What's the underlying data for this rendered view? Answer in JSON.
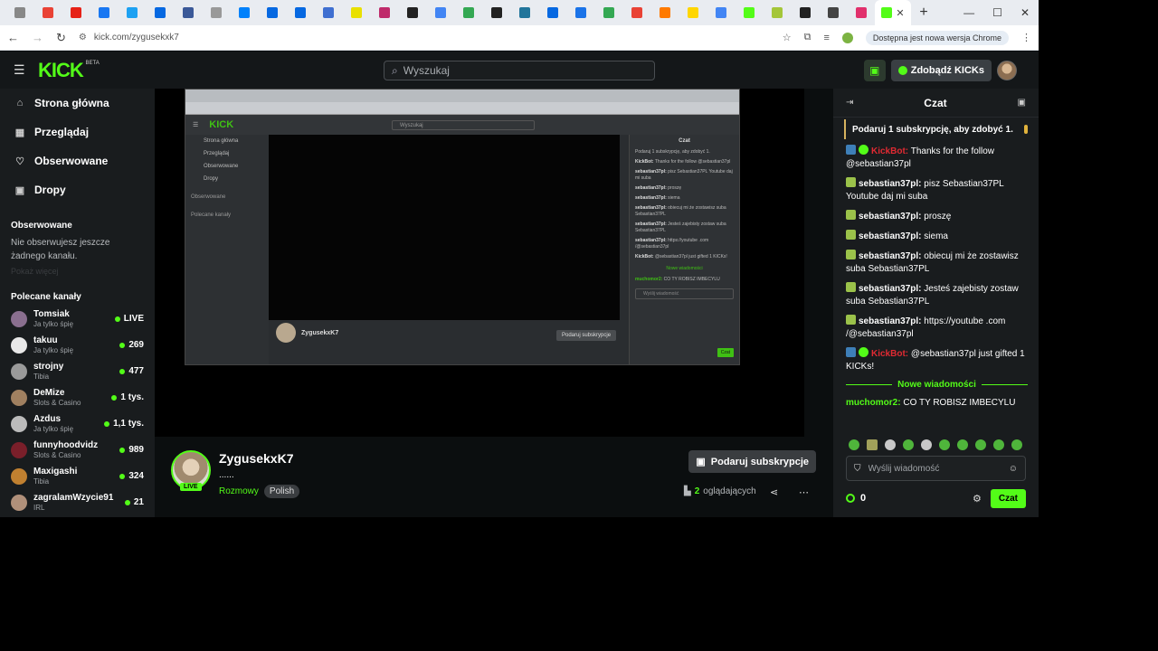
{
  "browser": {
    "tab_favicons": [
      "#888",
      "#e94235",
      "#e62117",
      "#1877f2",
      "#1da1f2",
      "#0668e1",
      "#3b5998",
      "#999",
      "#0081fb",
      "#0668e1",
      "#0668e1",
      "#3f6fd1",
      "#e9e000",
      "#bf2b6b",
      "#222",
      "#4285f4",
      "#34a853",
      "#222",
      "#21759b",
      "#0668e1",
      "#1a73e8",
      "#34a853",
      "#e94235",
      "#ff7a00",
      "#ffd600",
      "#4285f4",
      "#53fc18",
      "#a4c639",
      "#222",
      "#444",
      "#e1306c"
    ],
    "url": "kick.com/zygusekxk7",
    "update_text": "Dostępna jest nowa wersja Chrome",
    "new_tab": "+",
    "close_tab": "✕"
  },
  "header": {
    "logo": "KICK",
    "logo_beta": "BETA",
    "search_placeholder": "Wyszukaj",
    "get_kicks": "Zdobądź KICKs"
  },
  "sidebar": {
    "nav": [
      {
        "label": "Strona główna",
        "icon": "home-icon",
        "glyph": "⌂"
      },
      {
        "label": "Przeglądaj",
        "icon": "browse-icon",
        "glyph": "▦"
      },
      {
        "label": "Obserwowane",
        "icon": "heart-icon",
        "glyph": "♡"
      },
      {
        "label": "Dropy",
        "icon": "gift-icon",
        "glyph": "▣"
      }
    ],
    "followed_title": "Obserwowane",
    "followed_empty": "Nie obserwujesz jeszcze żadnego kanału.",
    "followed_more": "Pokaż więcej",
    "recommended_title": "Polecane kanały",
    "channels": [
      {
        "name": "Tomsiak",
        "category": "Ja tylko śpię",
        "count": "LIVE",
        "color": "#8a6f8f"
      },
      {
        "name": "takuu",
        "category": "Ja tylko śpię",
        "count": "269",
        "color": "#e8e8e8"
      },
      {
        "name": "strojny",
        "category": "Tibia",
        "count": "477",
        "color": "#9a9a9a"
      },
      {
        "name": "DeMize",
        "category": "Slots & Casino",
        "count": "1 tys.",
        "color": "#a08060"
      },
      {
        "name": "Azdus",
        "category": "Ja tylko śpię",
        "count": "1,1 tys.",
        "color": "#bbb"
      },
      {
        "name": "funnyhoodvidz",
        "category": "Slots & Casino",
        "count": "989",
        "color": "#7a1f2a"
      },
      {
        "name": "Maxigashi",
        "category": "Tibia",
        "count": "324",
        "color": "#c08030"
      },
      {
        "name": "zagralamWzycie91",
        "category": "IRL",
        "count": "21",
        "color": "#b0907a"
      }
    ]
  },
  "stream": {
    "streamer": "ZygusekxK7",
    "title": "......",
    "category": "Rozmowy",
    "language": "Polish",
    "live": "LIVE",
    "subscribe": "Podaruj subskrypcje",
    "viewers_count": "2",
    "viewers_label": "oglądających"
  },
  "embed": {
    "logo": "KICK",
    "search": "Wyszukaj",
    "streamer": "ZygusekxK7",
    "subscribe": "Podaruj subskrypcje",
    "chat_title": "Czat",
    "side_nav": [
      "Strona główna",
      "Przeglądaj",
      "Obserwowane",
      "Dropy"
    ],
    "side_followed": "Obserwowane",
    "side_recommended": "Polecane kanały",
    "chat_lines": [
      {
        "user": "",
        "text": "Podaruj 1 subskrypcję, aby zdobyć 1."
      },
      {
        "user": "KickBot:",
        "text": "Thanks for the follow @sebastian37pl"
      },
      {
        "user": "sebastian37pl:",
        "text": "pisz Sebastian37PL Youtube daj mi suba"
      },
      {
        "user": "sebastian37pl:",
        "text": "proszę"
      },
      {
        "user": "sebastian37pl:",
        "text": "siema"
      },
      {
        "user": "sebastian37pl:",
        "text": "obiecuj mi że zostawisz suba Sebastian37PL"
      },
      {
        "user": "sebastian37pl:",
        "text": "Jesteś zajebisty zostaw suba Sebastian37PL"
      },
      {
        "user": "sebastian37pl:",
        "text": "https://youtube .com /@sebastian37pl"
      },
      {
        "user": "KickBot:",
        "text": "@sebastian37pl just gifted 1 KICKs!"
      }
    ],
    "new_msgs": "Nowe wiadomości",
    "last_line": {
      "user": "muchomor2:",
      "text": "CO TY ROBISZ IMBECYLU"
    },
    "input_placeholder": "Wyślij wiadomość",
    "send": "Czat"
  },
  "chat": {
    "title": "Czat",
    "pinned": "Podaruj 1 subskrypcję, aby zdobyć 1.",
    "messages": [
      {
        "user": "KickBot",
        "text": "Thanks for the follow @sebastian37pl",
        "type": "bot"
      },
      {
        "user": "sebastian37pl",
        "text": "pisz Sebastian37PL Youtube daj mi suba",
        "type": "sub"
      },
      {
        "user": "sebastian37pl",
        "text": "proszę",
        "type": "sub"
      },
      {
        "user": "sebastian37pl",
        "text": "siema",
        "type": "sub"
      },
      {
        "user": "sebastian37pl",
        "text": "obiecuj mi że zostawisz suba Sebastian37PL",
        "type": "sub"
      },
      {
        "user": "sebastian37pl",
        "text": "Jesteś zajebisty zostaw suba Sebastian37PL",
        "type": "sub"
      },
      {
        "user": "sebastian37pl",
        "text": "https://youtube .com /@sebastian37pl",
        "type": "sub"
      },
      {
        "user": "KickBot",
        "text": "@sebastian37pl just gifted 1 KICKs!",
        "type": "bot"
      }
    ],
    "new_messages": "Nowe wiadomości",
    "last_message": {
      "user": "muchomor2",
      "text": "CO TY ROBISZ IMBECYLU"
    },
    "input_placeholder": "Wyślij wiadomość",
    "points": "0",
    "send": "Czat"
  },
  "colors": {
    "accent": "#53fc18",
    "bot_name": "#e02a32",
    "background": "#0b0e0f"
  }
}
